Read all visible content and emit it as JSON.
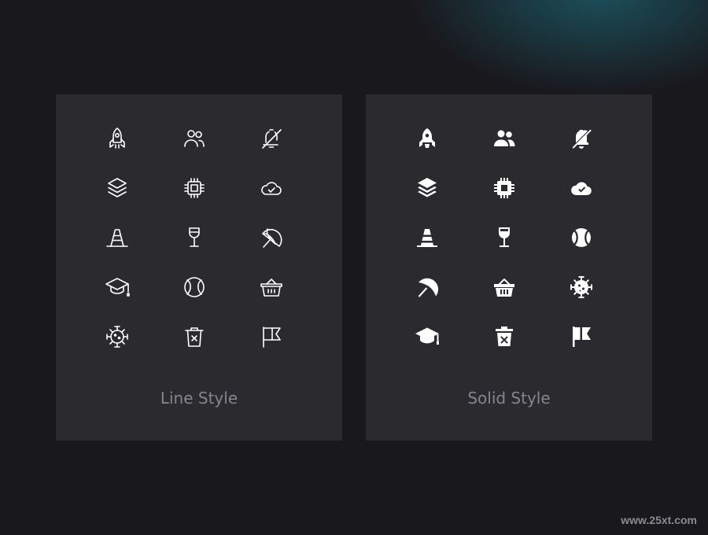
{
  "panels": {
    "line": {
      "caption": "Line Style",
      "icons": [
        "rocket-icon",
        "users-icon",
        "bell-off-icon",
        "layers-icon",
        "cpu-chip-icon",
        "cloud-check-icon",
        "traffic-cone-icon",
        "wine-glass-icon",
        "beach-umbrella-icon",
        "graduation-cap-icon",
        "tennis-ball-icon",
        "shopping-basket-icon",
        "virus-icon",
        "trash-x-icon",
        "flag-icon"
      ]
    },
    "solid": {
      "caption": "Solid Style",
      "icons": [
        "rocket-icon",
        "users-icon",
        "bell-off-icon",
        "layers-icon",
        "cpu-chip-icon",
        "cloud-check-icon",
        "traffic-cone-icon",
        "wine-glass-icon",
        "tennis-ball-icon",
        "beach-umbrella-icon",
        "shopping-basket-icon",
        "virus-icon",
        "graduation-cap-icon",
        "trash-x-icon",
        "flag-icon"
      ]
    }
  },
  "watermark": "www.25xt.com",
  "colors": {
    "background": "#19191d",
    "panel": "#2a2a2f",
    "caption": "#85858b",
    "icon": "#ffffff",
    "glow": "#1c6270"
  }
}
